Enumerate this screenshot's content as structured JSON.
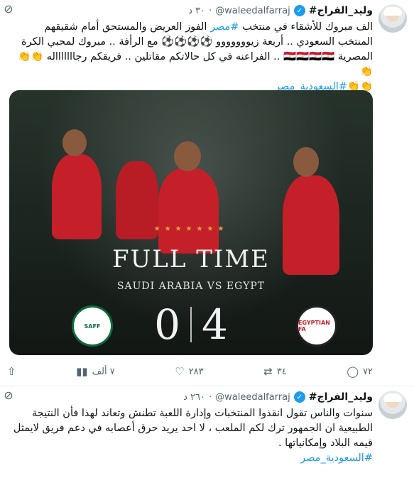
{
  "tweets": [
    {
      "name": "وليد_الفراج#",
      "handle": "@waleedalfarraj",
      "time": "٣٠ د",
      "text_lines": [
        "الف مبروك للأشقاء في منتخب",
        "الفوز العريض والمستحق أمام شقيقهم",
        "المنتخب السعودي .. أربعة زيووووووو ⚽⚽⚽⚽ مع الرأفة .. مبروك لمحبي الكرة",
        "المصرية 🇪🇬🇪🇬🇪🇬🇪🇬 .. الفراعنه في كل حالاتكم مقاتلين .. فريقكم رجاااااااله 👏👏👏"
      ],
      "hashtag_inline": "#مصر",
      "hashtag_end": "#السعودية_مصر",
      "hashtag_end_prefix": "👏👏",
      "media": {
        "stars": "★★★★★★★",
        "title": "FULL TIME",
        "match": "SAUDI ARABIA VS EGYPT",
        "home_score": "0",
        "away_score": "4",
        "home_badge": "SAFF",
        "away_badge": "EGYPTIAN FA"
      },
      "actions": {
        "views": "٧ ألف",
        "likes": "٢٨٣",
        "retweets": "٣٤",
        "replies": "٧٢"
      }
    },
    {
      "name": "وليد_الفراج#",
      "handle": "@waleedalfarraj",
      "time": "٢٦٠ د",
      "text": "سنوات والناس تقول انقذوا المنتخبات وإدارة اللعبة تطنش وتعاند لهذا فأن النتيجة الطبيعية ان الجمهور ترك لكم الملعب ، لا احد يريد حرق أعصابه في دعم فريق لايمثل قيمه البلاد وإمكانياتها .",
      "hashtag": "#السعودية_مصر"
    }
  ],
  "icons": {
    "verified": "verified-check-icon",
    "mute": "mute-icon",
    "share": "share-icon",
    "views": "views-icon",
    "like": "heart-icon",
    "retweet": "retweet-icon",
    "reply": "reply-icon"
  }
}
